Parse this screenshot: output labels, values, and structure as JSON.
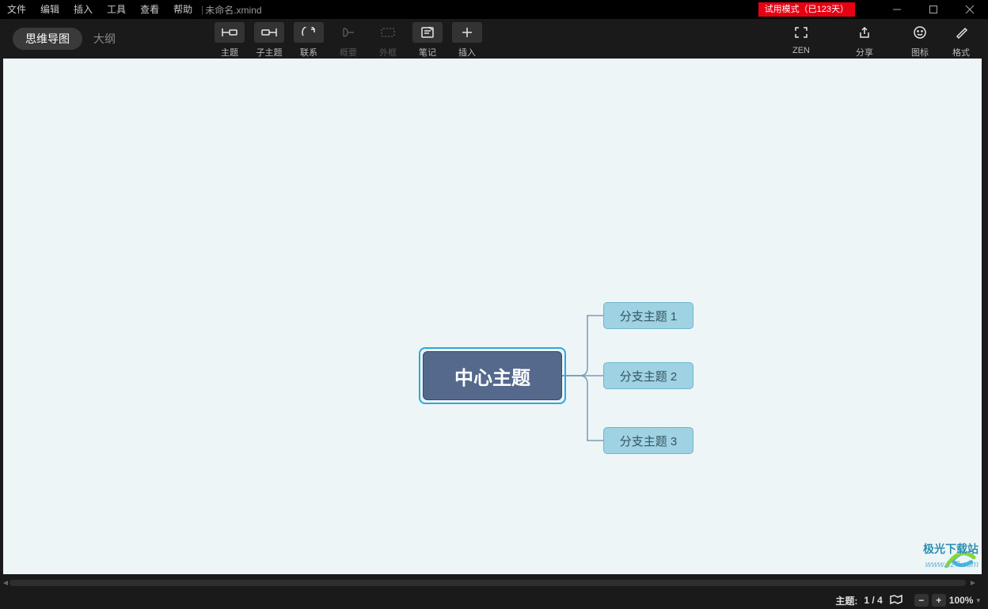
{
  "menubar": {
    "items": [
      "文件",
      "编辑",
      "插入",
      "工具",
      "查看",
      "帮助"
    ],
    "filename": "未命名.xmind"
  },
  "trial_badge": "试用模式（已123天）",
  "view_tabs": {
    "mindmap": "思维导图",
    "outline": "大纲"
  },
  "toolbar": {
    "topic": "主题",
    "subtopic": "子主题",
    "relation": "联系",
    "summary": "概要",
    "boundary": "外框",
    "note": "笔记",
    "insert": "插入",
    "zen": "ZEN",
    "share": "分享",
    "icons": "图标",
    "format": "格式"
  },
  "mindmap": {
    "central": "中心主题",
    "branches": [
      "分支主题 1",
      "分支主题 2",
      "分支主题 3"
    ]
  },
  "status": {
    "topic_label": "主题:",
    "topic_count": "1 / 4",
    "zoom": "100%"
  },
  "watermark": {
    "brand": "极光下载站",
    "url": "www.xz7.com"
  }
}
